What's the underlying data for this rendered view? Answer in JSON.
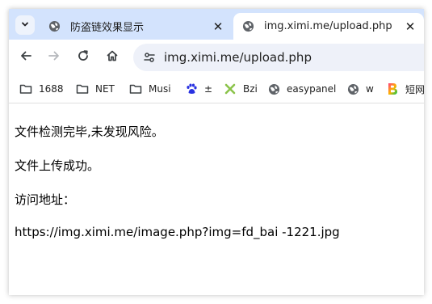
{
  "tabs": [
    {
      "title": "防盗链效果显示",
      "active": false,
      "icon": "globe-icon"
    },
    {
      "title": "img.ximi.me/upload.php",
      "active": true,
      "icon": "globe-icon"
    }
  ],
  "tab_close_glyph": "✕",
  "omnibox": {
    "url": "img.ximi.me/upload.php",
    "icon": "site-info-icon"
  },
  "bookmarks": [
    {
      "label": "1688",
      "icon": "folder-icon"
    },
    {
      "label": "NET",
      "icon": "folder-icon"
    },
    {
      "label": "Musi",
      "icon": "folder-icon"
    },
    {
      "label": "±",
      "icon": "baidu-paw-icon"
    },
    {
      "label": "Bzi",
      "icon": "x-logo-icon"
    },
    {
      "label": "easypanel",
      "icon": "globe-icon"
    },
    {
      "label": "w",
      "icon": "globe-icon"
    },
    {
      "label": "短网",
      "icon": "b-logo-icon"
    }
  ],
  "page": {
    "line1": "文件检测完毕,未发现风险。",
    "line2": "文件上传成功。",
    "line3": "访问地址：",
    "line4": "https://img.ximi.me/image.php?img=fd_bai -1221.jpg"
  },
  "colors": {
    "tabbar_bg": "#d3e3fd",
    "omnibox_bg": "#eef1f9",
    "baidu_blue": "#2932e1",
    "x_logo_green": "#8bc34a"
  }
}
